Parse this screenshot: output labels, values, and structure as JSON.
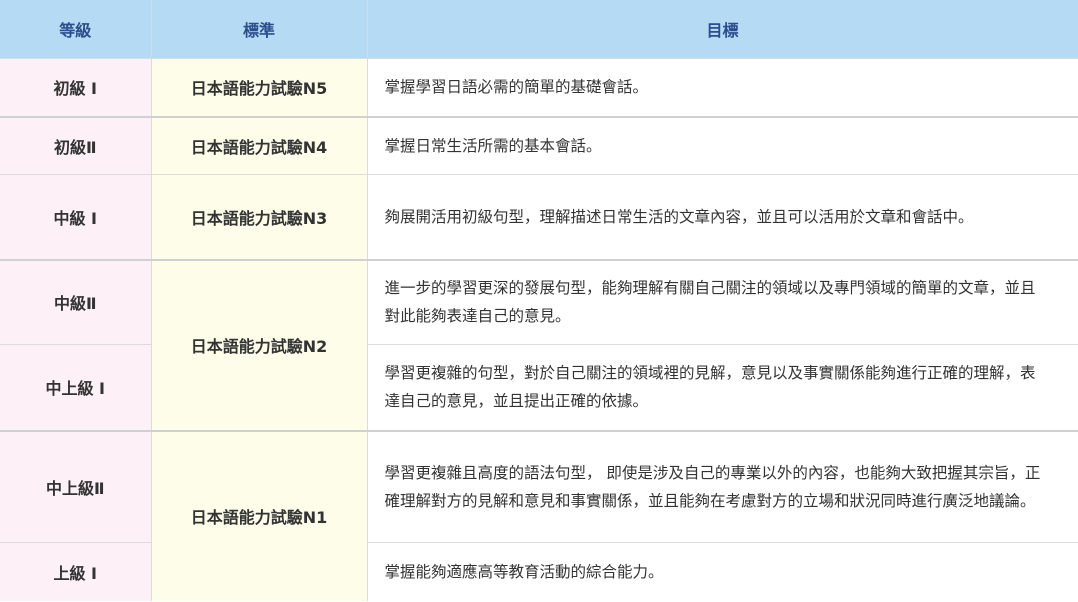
{
  "headers": {
    "level": "等級",
    "standard": "標準",
    "goal": "目標"
  },
  "rows": [
    {
      "level": "初級 I",
      "standard": "日本語能力試驗N5",
      "goal": "掌握學習日語必需的簡單的基礎會話。"
    },
    {
      "level": "初級Ⅱ",
      "standard": "日本語能力試驗N4",
      "goal": "掌握日常生活所需的基本會話。"
    },
    {
      "level": "中級 I",
      "standard": "日本語能力試驗N3",
      "goal": "夠展開活用初級句型，理解描述日常生活的文章內容，並且可以活用於文章和會話中。"
    },
    {
      "level": "中級Ⅱ",
      "standard": "日本語能力試驗N2",
      "goal": "進一步的學習更深的發展句型，能夠理解有關自己關注的領域以及專門領域的簡單的文章，並且對此能夠表達自己的意見。"
    },
    {
      "level": "中上級 I",
      "goal": "學習更複雜的句型，對於自己關注的領域裡的見解，意見以及事實關係能夠進行正確的理解，表達自己的意見，並且提出正確的依據。"
    },
    {
      "level": "中上級Ⅱ",
      "standard": "日本語能力試驗N1",
      "goal": "學習更複雜且高度的語法句型， 即使是涉及自己的專業以外的內容，也能夠大致把握其宗旨，正確理解對方的見解和意見和事實關係，並且能夠在考慮對方的立場和狀況同時進行廣泛地議論。"
    },
    {
      "level": "上級 I",
      "goal": "掌握能夠適應高等教育活動的綜合能力。"
    }
  ]
}
